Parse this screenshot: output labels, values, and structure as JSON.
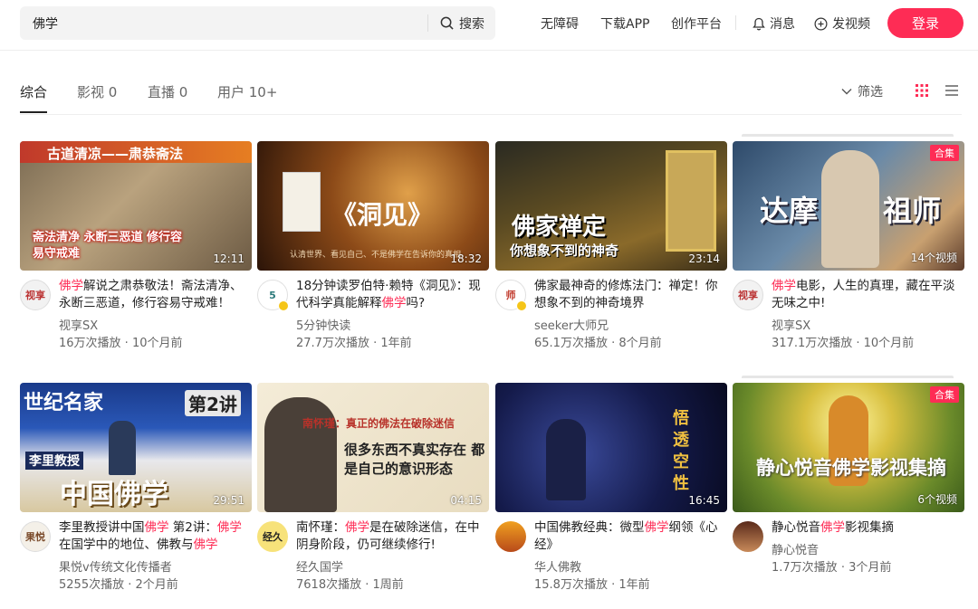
{
  "search": {
    "query": "佛学",
    "button_label": "搜索"
  },
  "nav": {
    "accessibility": "无障碍",
    "download": "下载APP",
    "creator": "创作平台",
    "messages": "消息",
    "upload": "发视频",
    "login": "登录"
  },
  "tabs": [
    {
      "label": "综合",
      "active": true
    },
    {
      "label": "影视 0",
      "active": false
    },
    {
      "label": "直播 0",
      "active": false
    },
    {
      "label": "用户 10+",
      "active": false
    }
  ],
  "filter_label": "筛选",
  "videos": [
    {
      "overlay_text": "古道清凉——肃恭斋法",
      "overlay_text_2": "斋法清净 永断三恶道 修行容易守戒难",
      "duration": "12:11",
      "title_parts": [
        "佛学",
        "解说之肃恭敬法！斋法清净、永断三恶道，修行容易守戒难！"
      ],
      "author": "视享SX",
      "views": "16万次播放",
      "time": "10个月前",
      "avatar_text": "视享",
      "badge": ""
    },
    {
      "overlay_text": "《洞见》",
      "overlay_text_2": "认清世界、看见自己、不是佛学在告诉你的真相",
      "duration": "18:32",
      "title_parts": [
        "18分钟读罗伯特·赖特《洞见》：现代科学真能解释",
        "佛学",
        "吗?"
      ],
      "author": "5分钟快读",
      "views": "27.7万次播放",
      "time": "1年前",
      "avatar_text": "5",
      "badge": ""
    },
    {
      "overlay_text": "佛家禅定",
      "overlay_text_2": "你想象不到的神奇",
      "duration": "23:14",
      "title_parts": [
        "佛家最神奇的修炼法门：禅定！你想象不到的神奇境界"
      ],
      "author": "seeker大师兄",
      "views": "65.1万次播放",
      "time": "8个月前",
      "avatar_text": "师",
      "badge": ""
    },
    {
      "overlay_text": "达摩",
      "overlay_text_2": "祖师",
      "duration": "14个视频",
      "title_parts": [
        "佛学",
        "电影，人生的真理，藏在平淡无味之中!"
      ],
      "author": "视享SX",
      "views": "317.1万次播放",
      "time": "10个月前",
      "avatar_text": "视享",
      "badge": "合集"
    },
    {
      "overlay_text": "世纪名家",
      "overlay_text_2": "中国佛学",
      "overlay_text_3": "第2讲",
      "overlay_text_4": "李里教授",
      "duration": "29:51",
      "title_parts": [
        "李里教授讲中国",
        "佛学",
        " 第2讲：",
        "佛学",
        "在国学中的地位、佛教与",
        "佛学"
      ],
      "author": "果悦v传统文化传播者",
      "views": "5255次播放",
      "time": "2个月前",
      "avatar_text": "果悦",
      "badge": ""
    },
    {
      "overlay_text": "南怀瑾：真正的佛法在破除迷信",
      "overlay_text_2": "很多东西不真实存在 都是自己的意识形态",
      "duration": "04:15",
      "title_parts": [
        "南怀瑾：",
        "佛学",
        "是在破除迷信，在中阴身阶段，仍可继续修行!"
      ],
      "author": "经久国学",
      "views": "7618次播放",
      "time": "1周前",
      "avatar_text": "经久",
      "badge": ""
    },
    {
      "overlay_text": "悟透空性",
      "duration": "16:45",
      "title_parts": [
        "中国佛教经典：微型",
        "佛学",
        "纲领《心经》"
      ],
      "author": "华人佛教",
      "views": "15.8万次播放",
      "time": "1年前",
      "avatar_text": "",
      "badge": ""
    },
    {
      "overlay_text": "静心悦音佛学影视集摘",
      "duration": "6个视频",
      "title_parts": [
        "静心悦音",
        "佛学",
        "影视集摘"
      ],
      "author": "静心悦音",
      "views": "1.7万次播放",
      "time": "3个月前",
      "avatar_text": "",
      "badge": "合集"
    }
  ],
  "colors": {
    "accent": "#fe2c55",
    "text": "#222222",
    "muted": "#666666"
  }
}
